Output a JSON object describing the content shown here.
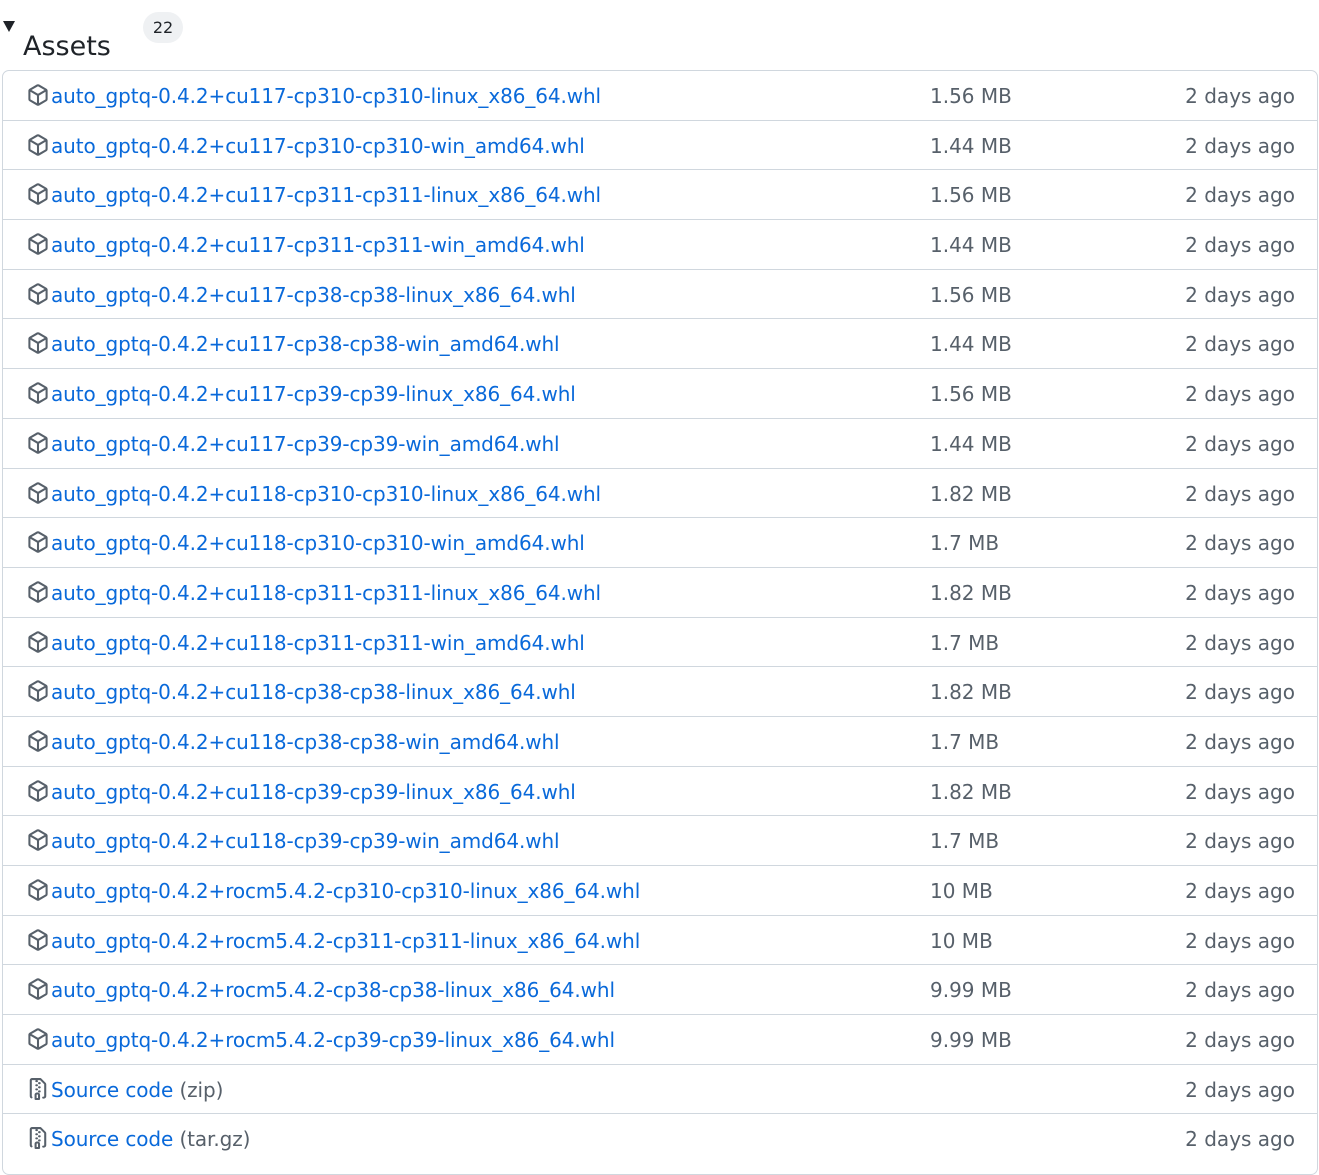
{
  "assets": {
    "title": "Assets",
    "count": "22",
    "rows": [
      {
        "name": "auto_gptq-0.4.2+cu117-cp310-cp310-linux_x86_64.whl",
        "size": "1.56 MB",
        "date": "2 days ago",
        "icon": "package-icon"
      },
      {
        "name": "auto_gptq-0.4.2+cu117-cp310-cp310-win_amd64.whl",
        "size": "1.44 MB",
        "date": "2 days ago",
        "icon": "package-icon"
      },
      {
        "name": "auto_gptq-0.4.2+cu117-cp311-cp311-linux_x86_64.whl",
        "size": "1.56 MB",
        "date": "2 days ago",
        "icon": "package-icon"
      },
      {
        "name": "auto_gptq-0.4.2+cu117-cp311-cp311-win_amd64.whl",
        "size": "1.44 MB",
        "date": "2 days ago",
        "icon": "package-icon"
      },
      {
        "name": "auto_gptq-0.4.2+cu117-cp38-cp38-linux_x86_64.whl",
        "size": "1.56 MB",
        "date": "2 days ago",
        "icon": "package-icon"
      },
      {
        "name": "auto_gptq-0.4.2+cu117-cp38-cp38-win_amd64.whl",
        "size": "1.44 MB",
        "date": "2 days ago",
        "icon": "package-icon"
      },
      {
        "name": "auto_gptq-0.4.2+cu117-cp39-cp39-linux_x86_64.whl",
        "size": "1.56 MB",
        "date": "2 days ago",
        "icon": "package-icon"
      },
      {
        "name": "auto_gptq-0.4.2+cu117-cp39-cp39-win_amd64.whl",
        "size": "1.44 MB",
        "date": "2 days ago",
        "icon": "package-icon"
      },
      {
        "name": "auto_gptq-0.4.2+cu118-cp310-cp310-linux_x86_64.whl",
        "size": "1.82 MB",
        "date": "2 days ago",
        "icon": "package-icon"
      },
      {
        "name": "auto_gptq-0.4.2+cu118-cp310-cp310-win_amd64.whl",
        "size": "1.7 MB",
        "date": "2 days ago",
        "icon": "package-icon"
      },
      {
        "name": "auto_gptq-0.4.2+cu118-cp311-cp311-linux_x86_64.whl",
        "size": "1.82 MB",
        "date": "2 days ago",
        "icon": "package-icon"
      },
      {
        "name": "auto_gptq-0.4.2+cu118-cp311-cp311-win_amd64.whl",
        "size": "1.7 MB",
        "date": "2 days ago",
        "icon": "package-icon"
      },
      {
        "name": "auto_gptq-0.4.2+cu118-cp38-cp38-linux_x86_64.whl",
        "size": "1.82 MB",
        "date": "2 days ago",
        "icon": "package-icon"
      },
      {
        "name": "auto_gptq-0.4.2+cu118-cp38-cp38-win_amd64.whl",
        "size": "1.7 MB",
        "date": "2 days ago",
        "icon": "package-icon"
      },
      {
        "name": "auto_gptq-0.4.2+cu118-cp39-cp39-linux_x86_64.whl",
        "size": "1.82 MB",
        "date": "2 days ago",
        "icon": "package-icon"
      },
      {
        "name": "auto_gptq-0.4.2+cu118-cp39-cp39-win_amd64.whl",
        "size": "1.7 MB",
        "date": "2 days ago",
        "icon": "package-icon"
      },
      {
        "name": "auto_gptq-0.4.2+rocm5.4.2-cp310-cp310-linux_x86_64.whl",
        "size": "10 MB",
        "date": "2 days ago",
        "icon": "package-icon"
      },
      {
        "name": "auto_gptq-0.4.2+rocm5.4.2-cp311-cp311-linux_x86_64.whl",
        "size": "10 MB",
        "date": "2 days ago",
        "icon": "package-icon"
      },
      {
        "name": "auto_gptq-0.4.2+rocm5.4.2-cp38-cp38-linux_x86_64.whl",
        "size": "9.99 MB",
        "date": "2 days ago",
        "icon": "package-icon"
      },
      {
        "name": "auto_gptq-0.4.2+rocm5.4.2-cp39-cp39-linux_x86_64.whl",
        "size": "9.99 MB",
        "date": "2 days ago",
        "icon": "package-icon"
      },
      {
        "name": "Source code",
        "suffix": "(zip)",
        "size": "",
        "date": "2 days ago",
        "icon": "file-zip-icon"
      },
      {
        "name": "Source code",
        "suffix": "(tar.gz)",
        "size": "",
        "date": "2 days ago",
        "icon": "file-zip-icon"
      }
    ]
  },
  "colors": {
    "link": "#0969da",
    "muted": "#57606a",
    "border": "#d0d7de",
    "badge_bg": "#eff1f3"
  }
}
